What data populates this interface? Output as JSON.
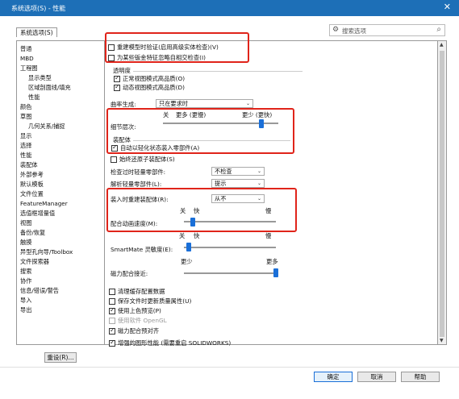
{
  "window": {
    "title": "系统选项(S) - 性能",
    "close": "✕"
  },
  "tab": {
    "label": "系统选项(S)"
  },
  "search": {
    "gear": "⚙",
    "placeholder": "搜索选项",
    "mag": "⌕"
  },
  "tree": [
    {
      "label": "普通",
      "level": 1
    },
    {
      "label": "MBD",
      "level": 1
    },
    {
      "label": "工程图",
      "level": 1
    },
    {
      "label": "显示类型",
      "level": 2
    },
    {
      "label": "区域剖面线/填充",
      "level": 2
    },
    {
      "label": "性能",
      "level": 2
    },
    {
      "label": "颜色",
      "level": 1
    },
    {
      "label": "草图",
      "level": 1
    },
    {
      "label": "几何关系/捕捉",
      "level": 2
    },
    {
      "label": "显示",
      "level": 1
    },
    {
      "label": "选择",
      "level": 1
    },
    {
      "label": "性能",
      "level": 1
    },
    {
      "label": "装配体",
      "level": 1
    },
    {
      "label": "外部参考",
      "level": 1
    },
    {
      "label": "默认模板",
      "level": 1
    },
    {
      "label": "文件位置",
      "level": 1
    },
    {
      "label": "FeatureManager",
      "level": 1
    },
    {
      "label": "选值框增量值",
      "level": 1
    },
    {
      "label": "视图",
      "level": 1
    },
    {
      "label": "备份/恢复",
      "level": 1
    },
    {
      "label": "触摸",
      "level": 1
    },
    {
      "label": "异型孔向导/Toolbox",
      "level": 1
    },
    {
      "label": "文件探索器",
      "level": 1
    },
    {
      "label": "搜索",
      "level": 1
    },
    {
      "label": "协作",
      "level": 1
    },
    {
      "label": "信息/错误/警告",
      "level": 1
    },
    {
      "label": "导入",
      "level": 1
    },
    {
      "label": "导出",
      "level": 1
    }
  ],
  "reset_button": "重设(R)...",
  "options": {
    "verify_rebuild": "重建模型时验证(启用高级实体检查)(V)",
    "ignore_self_intersect": "为某些钣金特征忽略自相交检查(I)",
    "transparency_title": "透明度",
    "transparency_normal": "正常视图模式高品质(O)",
    "transparency_dynamic": "动态视图模式高品质(D)",
    "curvature_label": "曲率生成:",
    "curvature_value": "只在要求时",
    "lod_off": "关",
    "lod_more": "更多 (更慢)",
    "lod_less": "更少 (更快)",
    "lod_label": "细节层次:",
    "assemblies_title": "装配体",
    "auto_lightweight": "自动以轻化状态装入零部件(A)",
    "always_resolve": "始终还原子装配体(S)",
    "check_lightweight_label": "检查过时轻量零部件:",
    "check_lightweight_value": "不检查",
    "resolve_lightweight_label": "解析轻量零部件(L):",
    "resolve_lightweight_value": "提示",
    "rebuild_on_load_label": "装入时重建装配体(R):",
    "rebuild_on_load_value": "从不",
    "mate_anim_off": "关",
    "mate_anim_fast": "快",
    "mate_anim_slow": "慢",
    "mate_anim_label": "配合动画速度(M):",
    "smartmate_off": "关",
    "smartmate_fast": "快",
    "smartmate_slow": "慢",
    "smartmate_label": "SmartMate 灵敏度(E):",
    "mate_less": "更少",
    "mate_more": "更多",
    "magnetic_label": "磁力配合接近:",
    "purge_cache": "清理缓存配置数据",
    "save_mass_props": "保存文件时更新质量属性(U)",
    "use_shaded_preview": "使用上色预览(P)",
    "use_software_opengl": "使用软件 OpenGL",
    "magnetic_mates": "磁力配合预对齐",
    "enhanced_graphics": "增强的图形性能 (需要重启 SOLIDWORKS)"
  },
  "sliders": {
    "lod": 0.85,
    "mate_anim": 0.1,
    "smartmate": 0.05,
    "magnetic": 1.0
  },
  "footer": {
    "ok": "确定",
    "cancel": "取消",
    "help": "帮助"
  },
  "colors": {
    "title_bar": "#1d6fb7",
    "highlight": "#e0241a",
    "accent": "#1a6fd8"
  }
}
